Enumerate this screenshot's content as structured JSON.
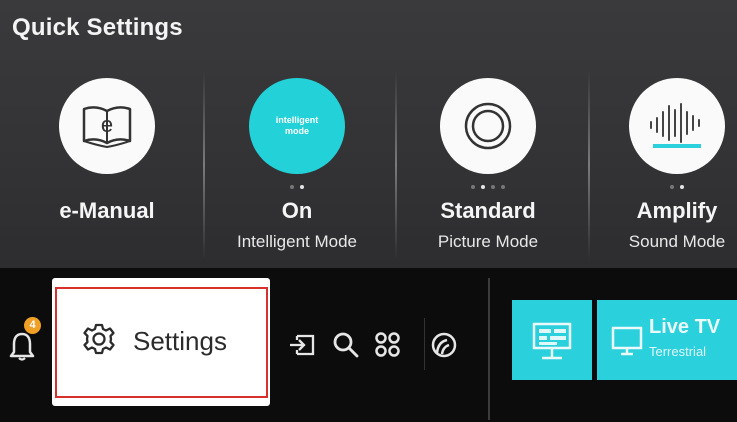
{
  "quick_settings": {
    "title": "Quick Settings",
    "tiles": [
      {
        "value": "e-Manual",
        "sub": "",
        "icon": "book-icon"
      },
      {
        "value": "On",
        "sub": "Intelligent Mode",
        "icon": "intelligent-mode-icon",
        "icon_text": "intelligent mode"
      },
      {
        "value": "Standard",
        "sub": "Picture Mode",
        "icon": "picture-mode-icon"
      },
      {
        "value": "Amplify",
        "sub": "Sound Mode",
        "icon": "sound-wave-icon"
      }
    ]
  },
  "bottom_bar": {
    "notification_count": "4",
    "settings_label": "Settings",
    "live_tv": {
      "name": "Live TV",
      "sub": "Terrestrial"
    }
  },
  "colors": {
    "accent_teal": "#2ad0dc",
    "highlight_red": "#d8302c",
    "badge_orange": "#f0a024"
  }
}
